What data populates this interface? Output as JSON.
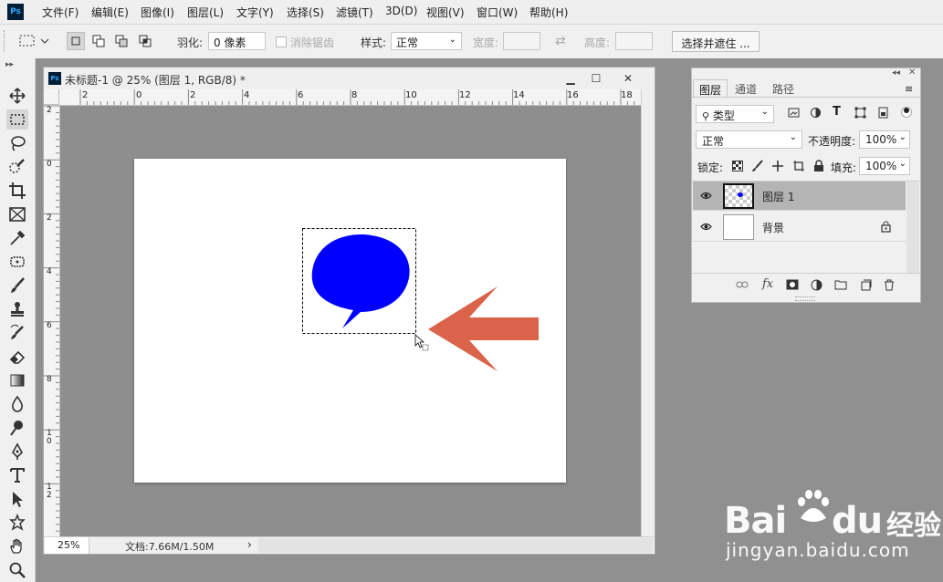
{
  "app": {
    "logo_text": "Ps"
  },
  "menu": [
    "文件(F)",
    "编辑(E)",
    "图像(I)",
    "图层(L)",
    "文字(Y)",
    "选择(S)",
    "滤镜(T)",
    "3D(D)",
    "视图(V)",
    "窗口(W)",
    "帮助(H)"
  ],
  "options": {
    "feather_label": "羽化:",
    "feather_value": "0 像素",
    "antialias_label": "消除锯齿",
    "style_label": "样式:",
    "style_value": "正常",
    "width_label": "宽度:",
    "height_label": "高度:",
    "select_mask_label": "选择并遮住 ..."
  },
  "document": {
    "title": "未标题-1 @ 25% (图层 1, RGB/8) *",
    "minimize": "▁",
    "maximize": "☐",
    "close": "✕",
    "hruler_labels": [
      "2",
      "0",
      "2",
      "4",
      "6",
      "8",
      "10",
      "12",
      "14",
      "16",
      "18"
    ],
    "vruler_labels": [
      "2",
      "0",
      "2",
      "4",
      "6",
      "8",
      "1\n0",
      "1\n2"
    ],
    "zoom": "25%",
    "doc_size": "文档:7.66M/1.50M",
    "status_arrow": "›"
  },
  "layers_panel": {
    "tabs": [
      "图层",
      "通道",
      "路径"
    ],
    "filter_kind": "类型",
    "blend_mode": "正常",
    "opacity_label": "不透明度:",
    "opacity_value": "100%",
    "lock_label": "锁定:",
    "fill_label": "填充:",
    "fill_value": "100%",
    "layers": [
      {
        "name": "图层 1",
        "selected": true
      },
      {
        "name": "背景",
        "selected": false,
        "locked": true
      }
    ],
    "bottom_icons": [
      "link-icon",
      "fx-icon",
      "mask-icon",
      "adjustment-icon",
      "folder-icon",
      "new-layer-icon",
      "trash-icon"
    ],
    "fx_label": "fx"
  },
  "canvas_colors": {
    "bubble": "#0000ff",
    "arrow": "#d9644a"
  },
  "watermark": {
    "brand": "Bai",
    "brand2": "du",
    "suffix": "经验",
    "url": "jingyan.baidu.com"
  }
}
